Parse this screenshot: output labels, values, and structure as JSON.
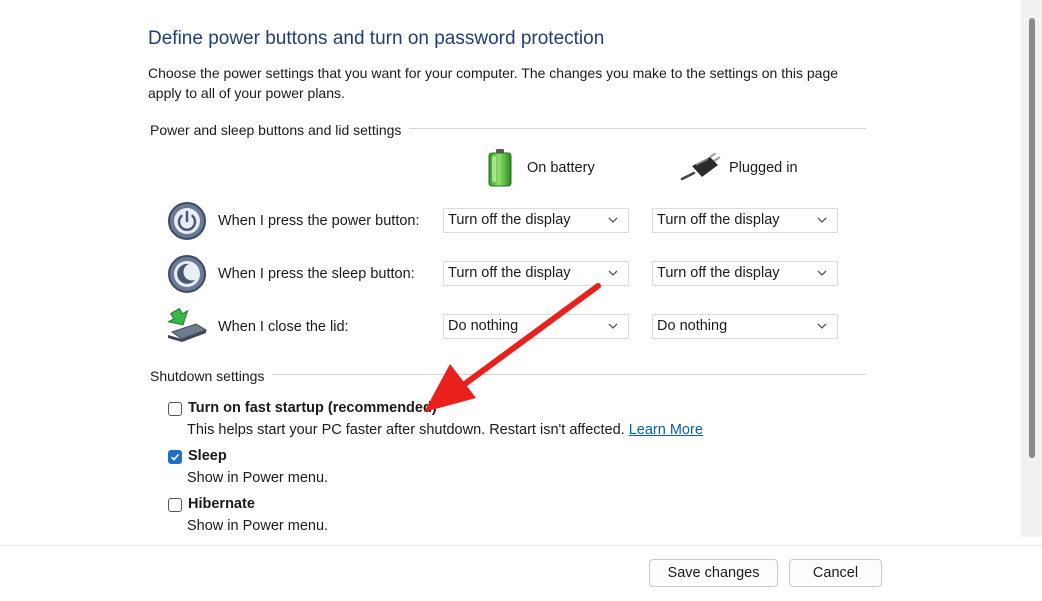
{
  "header": {
    "title": "Define power buttons and turn on password protection",
    "intro": "Choose the power settings that you want for your computer. The changes you make to the settings on this page apply to all of your power plans."
  },
  "power_group": {
    "title": "Power and sleep buttons and lid settings",
    "columns": {
      "battery": "On battery",
      "plugged": "Plugged in"
    },
    "rows": [
      {
        "icon": "power-button-icon",
        "label": "When I press the power button:",
        "battery": "Turn off the display",
        "plugged": "Turn off the display"
      },
      {
        "icon": "sleep-button-icon",
        "label": "When I press the sleep button:",
        "battery": "Turn off the display",
        "plugged": "Turn off the display"
      },
      {
        "icon": "laptop-lid-icon",
        "label": "When I close the lid:",
        "battery": "Do nothing",
        "plugged": "Do nothing"
      }
    ]
  },
  "shutdown_group": {
    "title": "Shutdown settings",
    "options": [
      {
        "title": "Turn on fast startup (recommended)",
        "desc": "This helps start your PC faster after shutdown. Restart isn't affected.",
        "link": "Learn More",
        "checked": false
      },
      {
        "title": "Sleep",
        "desc": "Show in Power menu.",
        "checked": true
      },
      {
        "title": "Hibernate",
        "desc": "Show in Power menu.",
        "checked": false
      }
    ]
  },
  "footer": {
    "save": "Save changes",
    "cancel": "Cancel"
  },
  "colors": {
    "title": "#1f3f73",
    "link": "#0b5cad",
    "checkbox_checked": "#1f6fc5",
    "annotation_arrow": "#e8211c"
  }
}
